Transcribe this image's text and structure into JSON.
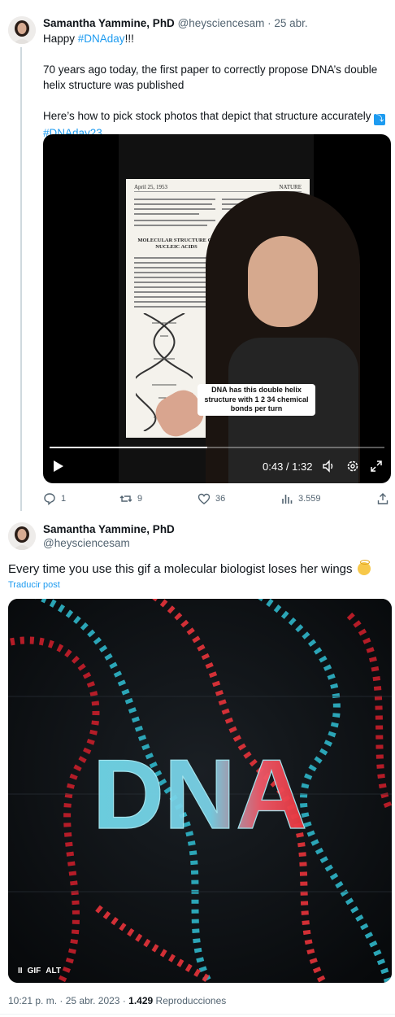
{
  "tweet1": {
    "author_name": "Samantha Yammine, PhD",
    "handle": "@heysciencesam",
    "separator": "·",
    "date": "25 abr.",
    "line1_prefix": "Happy ",
    "line1_hashtag": "#DNAday",
    "line1_suffix": "!!!",
    "paragraph2": "70 years ago today, the first paper to correctly propose DNA’s double helix structure was published",
    "paragraph3": "Here’s how to pick stock photos that depict that structure accurately",
    "paragraph3_emoji": "⤵",
    "hashtag2": "#DNAday23",
    "video": {
      "paper_date": "April 25, 1953",
      "paper_journal": "NATURE",
      "paper_title": "MOLECULAR STRUCTURE OF NUCLEIC ACIDS",
      "caption": "DNA has this double helix structure with 1 2 34 chemical bonds per turn",
      "time_display": "0:43 / 1:32",
      "progress_fraction": 0.47
    },
    "actions": {
      "replies": "1",
      "reposts": "9",
      "likes": "36",
      "views": "3.559"
    }
  },
  "tweet2": {
    "author_name": "Samantha Yammine, PhD",
    "handle": "@heysciencesam",
    "text": "Every time you use this gif a molecular biologist loses her wings",
    "translate_label": "Traducir post",
    "gif": {
      "word": "DNA",
      "pause_label": "II",
      "gif_label": "GIF",
      "alt_label": "ALT"
    },
    "meta": {
      "time": "10:21 p. m.",
      "separator": "·",
      "date": "25 abr. 2023",
      "views_count": "1.429",
      "views_label": "Reproducciones"
    }
  },
  "colors": {
    "link": "#1d9bf0",
    "muted": "#536471",
    "dna_red": "#e8333a",
    "dna_cyan": "#2fb6c9"
  }
}
